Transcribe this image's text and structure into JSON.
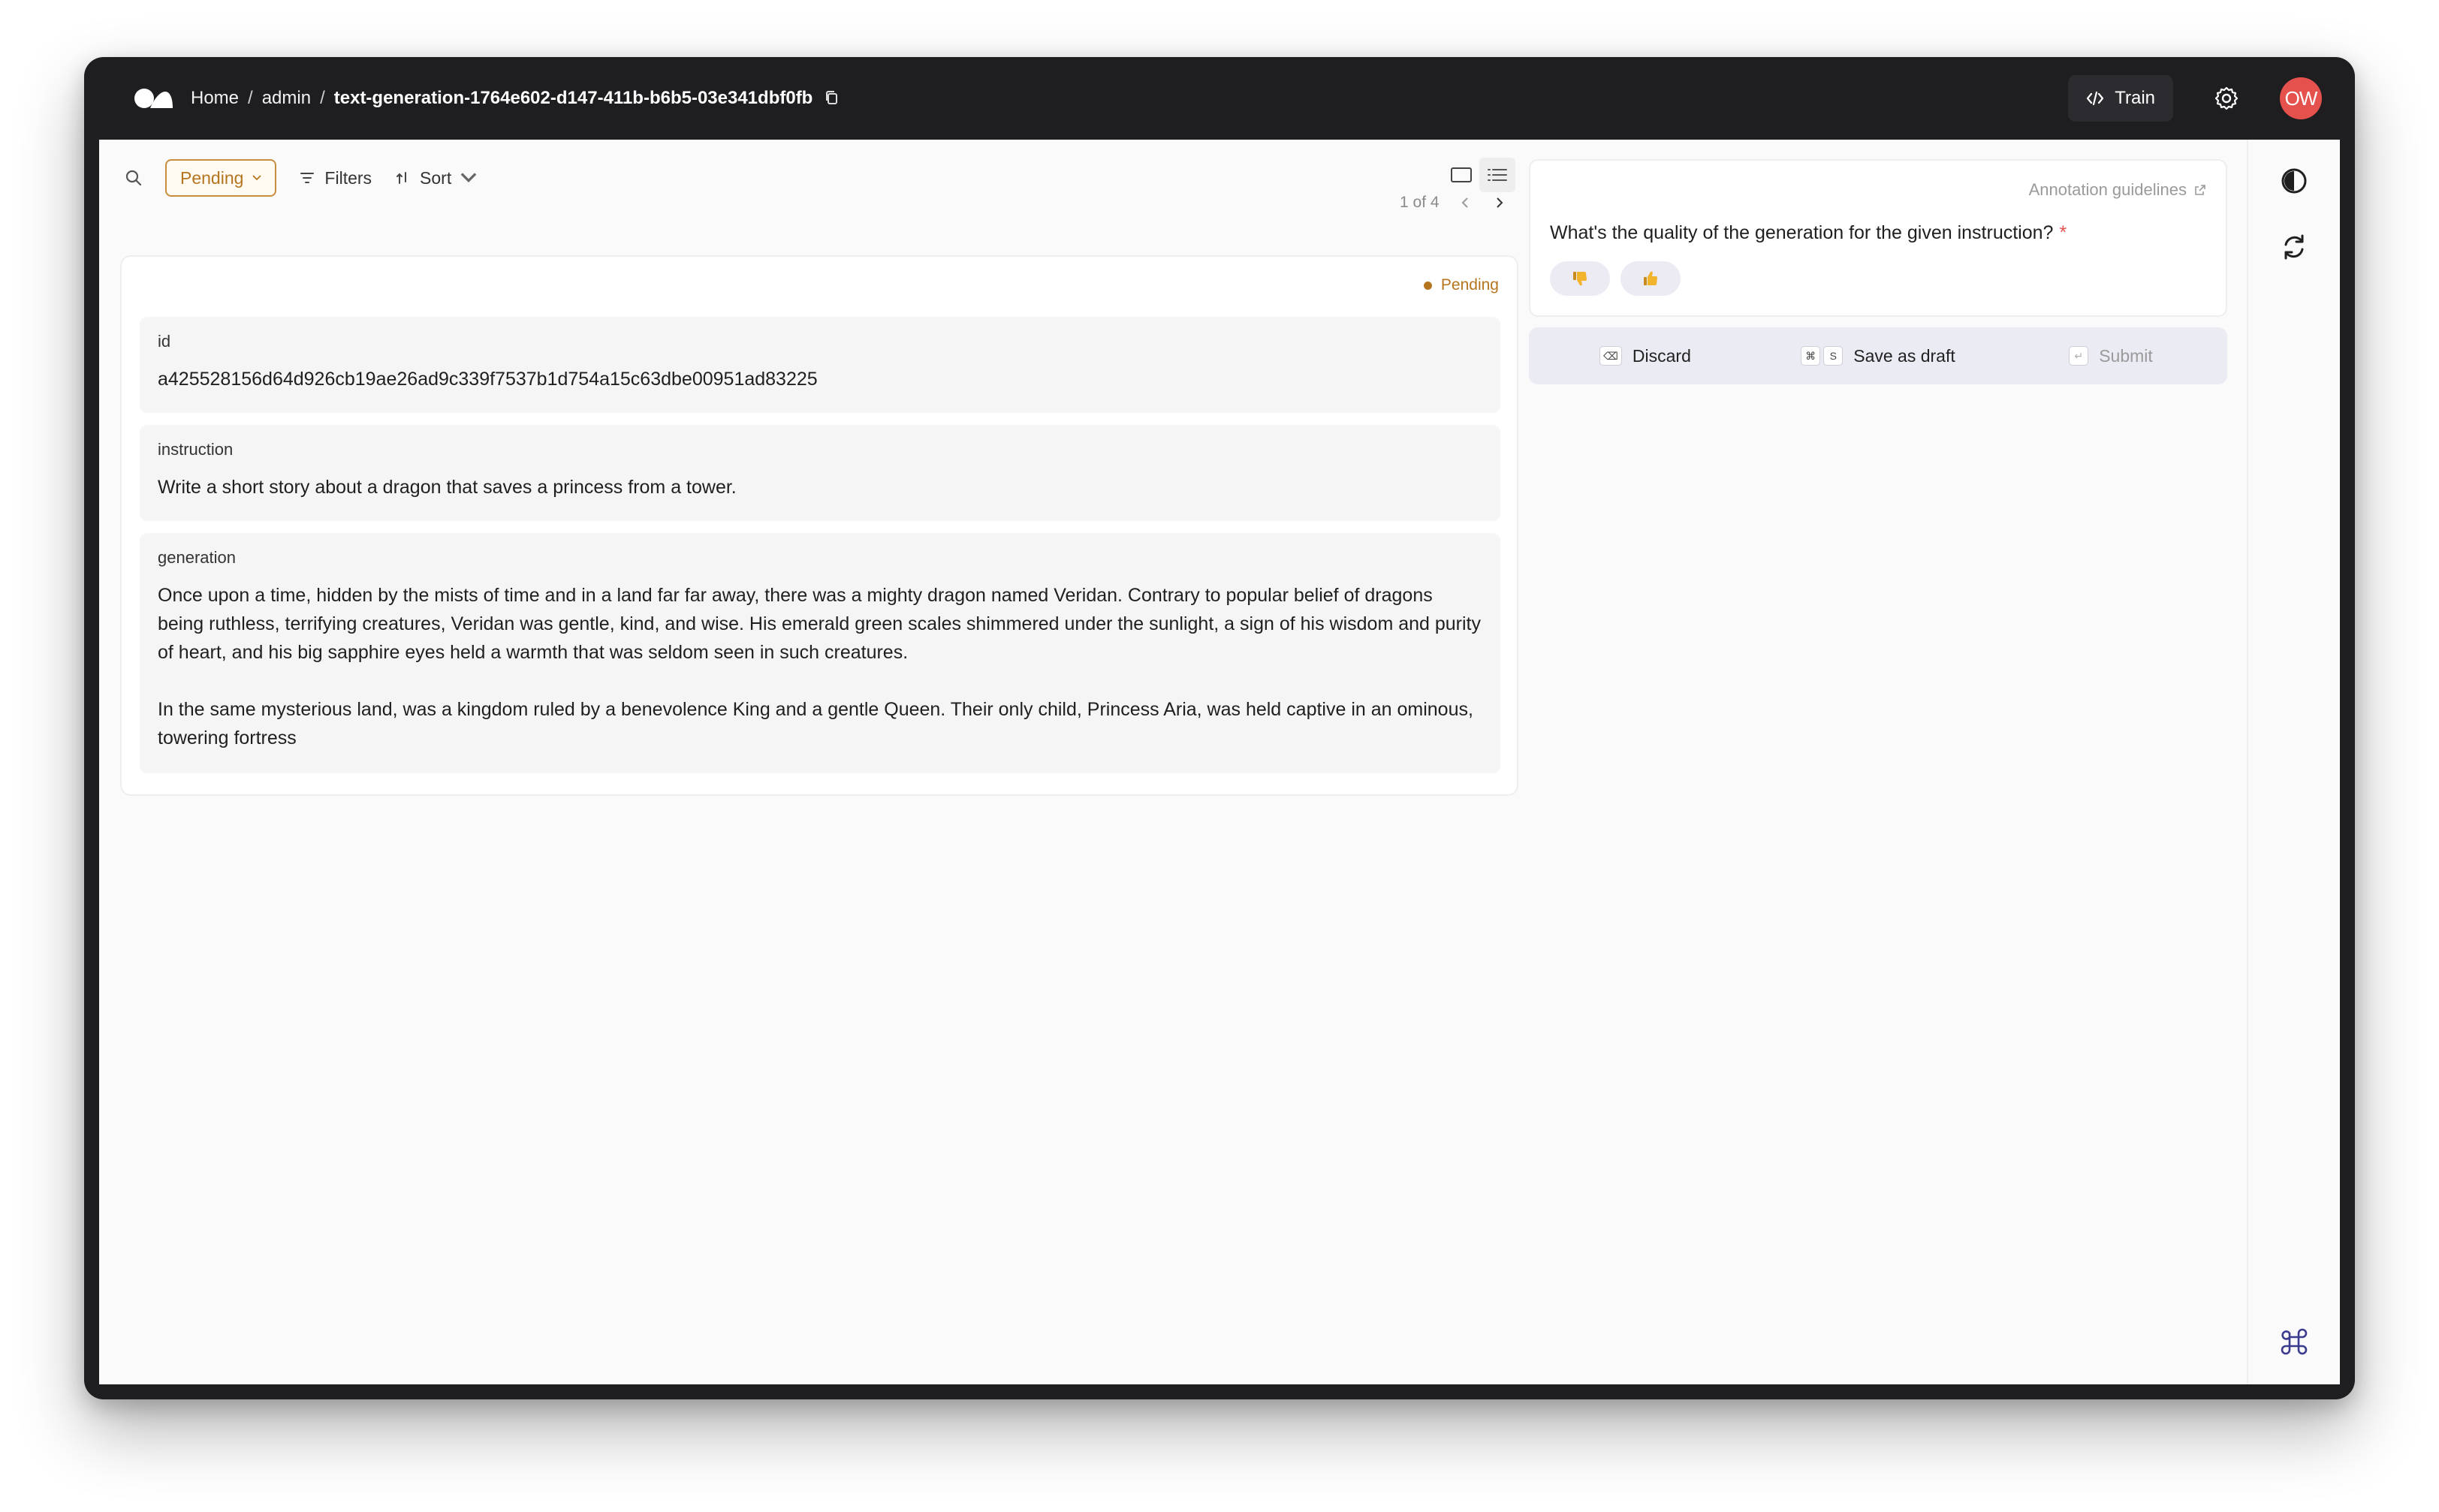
{
  "header": {
    "breadcrumb": {
      "home": "Home",
      "sep1": "/",
      "workspace": "admin",
      "sep2": "/",
      "dataset": "text-generation-1764e602-d147-411b-b6b5-03e341dbf0fb"
    },
    "train_label": "Train",
    "avatar_initials": "OW"
  },
  "toolbar": {
    "status_filter": "Pending",
    "filters_label": "Filters",
    "sort_label": "Sort"
  },
  "pager": {
    "text": "1 of 4"
  },
  "record": {
    "status": "Pending",
    "fields": [
      {
        "label": "id",
        "value": "a425528156d64d926cb19ae26ad9c339f7537b1d754a15c63dbe00951ad83225"
      },
      {
        "label": "instruction",
        "value": "Write a short story about a dragon that saves a princess from a tower."
      },
      {
        "label": "generation",
        "value": "Once upon a time, hidden by the mists of time and in a land far far away, there was a mighty dragon named Veridan. Contrary to popular belief of dragons being ruthless, terrifying creatures, Veridan was gentle, kind, and wise. His emerald green scales shimmered under the sunlight, a sign of his wisdom and purity of heart, and his big sapphire eyes held a warmth that was seldom seen in such creatures.\n\nIn the same mysterious land, was a kingdom ruled by a benevolence King and a gentle Queen. Their only child, Princess Aria, was held captive in an ominous, towering fortress"
      }
    ]
  },
  "question_panel": {
    "guidelines_label": "Annotation guidelines",
    "question": "What's the quality of the generation for the given instruction?",
    "required_mark": "*",
    "options": [
      "thumbs-down-icon",
      "thumbs-up-icon"
    ]
  },
  "actions": {
    "discard_label": "Discard",
    "discard_key": "⌫",
    "draft_label": "Save as draft",
    "draft_key1": "⌘",
    "draft_key2": "S",
    "submit_label": "Submit",
    "submit_key": "↵"
  },
  "colors": {
    "pending": "#b5751f",
    "avatar": "#e5524d",
    "topbar": "#1e1d20",
    "action_bar": "#ebebf4",
    "rail_accent": "#3b3b8f"
  }
}
